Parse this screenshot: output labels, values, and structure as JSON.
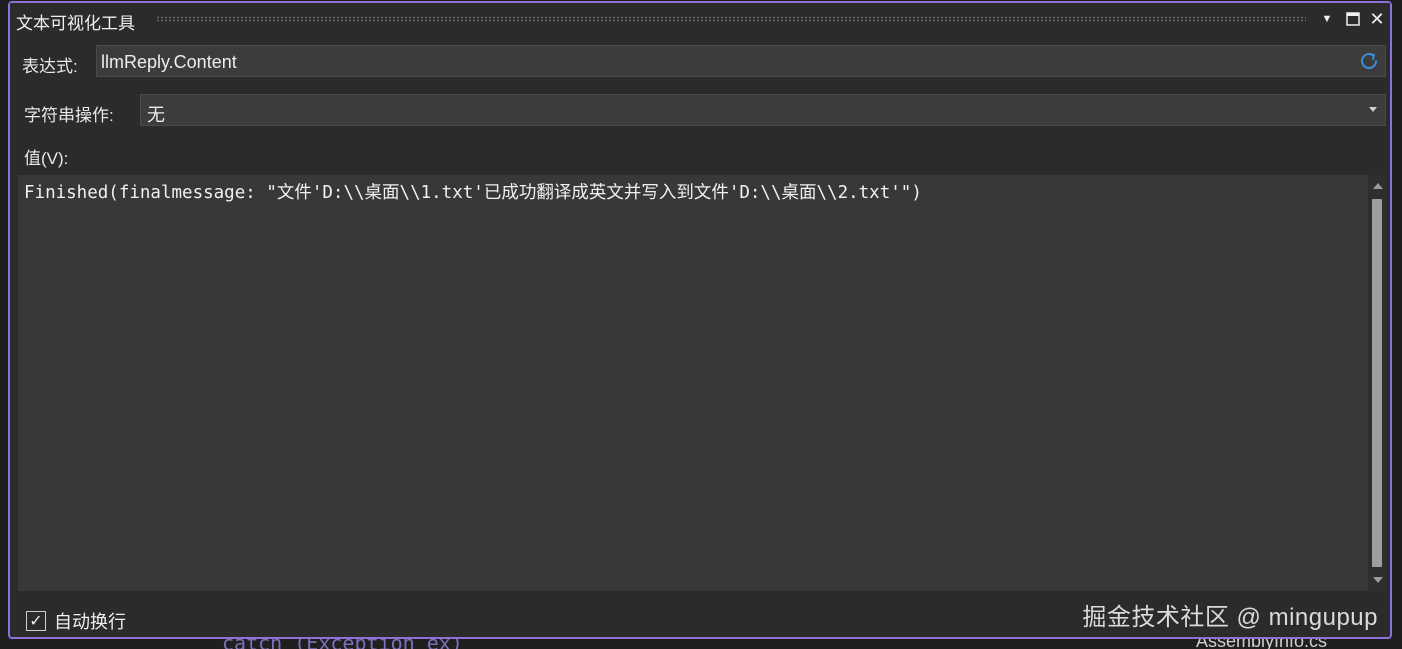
{
  "window": {
    "title": "文本可视化工具",
    "dropdown_icon": "▼",
    "maximize_icon": "▣",
    "close_icon": "✕"
  },
  "expression": {
    "label": "表达式:",
    "value": "llmReply.Content",
    "refresh_icon": "refresh-icon"
  },
  "string_operation": {
    "label": "字符串操作:",
    "selected": "无"
  },
  "value": {
    "label": "值(V):",
    "text": "Finished(finalmessage: \"文件'D:\\\\桌面\\\\1.txt'已成功翻译成英文并写入到文件'D:\\\\桌面\\\\2.txt'\")"
  },
  "word_wrap": {
    "label": "自动换行",
    "checked": true,
    "check_mark": "✓"
  },
  "watermark": {
    "text": "掘金技术社区 @ mingupup"
  },
  "background": {
    "code_fragment": "catch (Exception ex)",
    "file_fragment": "AssemblyInfo.cs"
  },
  "colors": {
    "accent_border": "#8c72d6",
    "refresh_icon": "#3c8cd6"
  }
}
